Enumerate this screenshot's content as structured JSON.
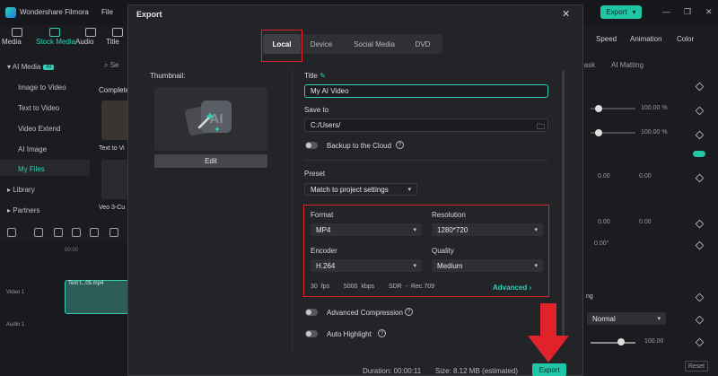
{
  "app": {
    "name": "Wondershare Filmora",
    "menu_file": "File",
    "top_export": "Export",
    "tools": [
      {
        "label": "Media"
      },
      {
        "label": "Stock Media"
      },
      {
        "label": "Audio"
      },
      {
        "label": "Title"
      }
    ],
    "sidebar": [
      {
        "label": "AI Media",
        "badge": "AI"
      },
      {
        "label": "Image to Video"
      },
      {
        "label": "Text to Video"
      },
      {
        "label": "Video Extend"
      },
      {
        "label": "AI Image"
      },
      {
        "label": "My Files"
      },
      {
        "label": "Library"
      },
      {
        "label": "Partners"
      }
    ],
    "media": {
      "section": "Complete",
      "item1": "Text to Vi",
      "item2": "Veo 3-Cu",
      "search_short": "Se"
    },
    "timeline": {
      "clip_label": "Text t...05.mp4",
      "time": "00:00",
      "track_video": "Video 1",
      "track_audio": "Audio 1"
    },
    "right_panel": {
      "tabs": [
        "Speed",
        "Animation",
        "Color"
      ],
      "sub_tabs": [
        "Mask",
        "AI Matting"
      ],
      "values": [
        "100.00",
        "%",
        "100.00",
        "%",
        "0.00",
        "0.00",
        "0.00",
        "0.00",
        "0.00°",
        "Normal",
        "100.00",
        "Reset"
      ],
      "section_short": "ng"
    }
  },
  "dialog": {
    "title": "Export",
    "tabs": [
      {
        "label": "Local",
        "active": true
      },
      {
        "label": "Device",
        "active": false
      },
      {
        "label": "Social Media",
        "active": false
      },
      {
        "label": "DVD",
        "active": false
      }
    ],
    "thumbnail_label": "Thumbnail:",
    "edit_label": "Edit",
    "title_label": "Title",
    "title_value": "My AI Video",
    "save_to_label": "Save to",
    "save_to_value": "C:/Users/",
    "backup_label": "Backup to the Cloud",
    "preset_label": "Preset",
    "preset_value": "Match to project settings",
    "format_label": "Format",
    "format_value": "MP4",
    "resolution_label": "Resolution",
    "resolution_value": "1280*720",
    "encoder_label": "Encoder",
    "encoder_value": "H.264",
    "quality_label": "Quality",
    "quality_value": "Medium",
    "specs": {
      "fps": "30 fps",
      "bitrate": "5000 kbps",
      "color": "SDR - Rec.709"
    },
    "advanced_label": "Advanced",
    "advanced_compression_label": "Advanced Compression",
    "auto_highlight_label": "Auto Highlight",
    "duration": "Duration: 00:00:11",
    "size": "Size: 8.12 MB (estimated)",
    "export_label": "Export"
  },
  "colors": {
    "accent": "#1fc7a7",
    "highlight": "#e0222b"
  }
}
